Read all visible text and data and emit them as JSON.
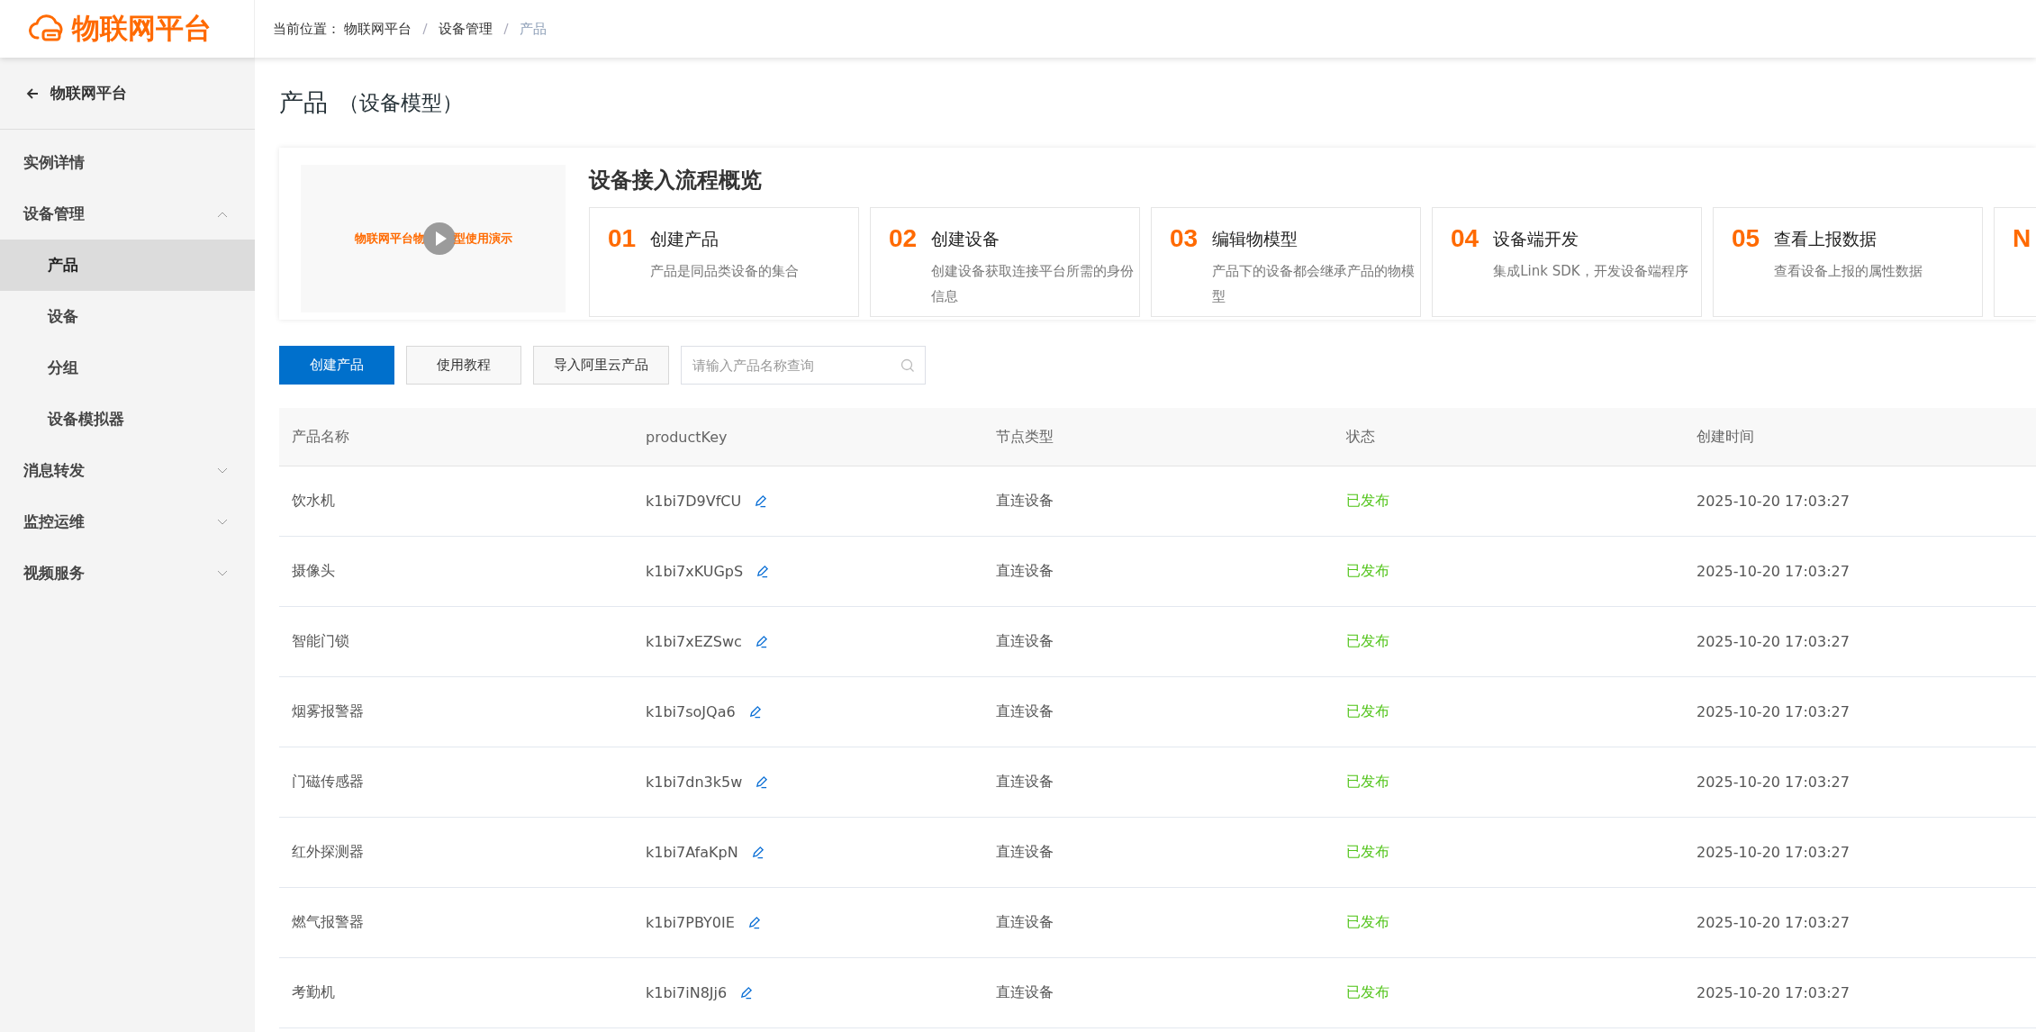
{
  "header": {
    "logo": "物联网平台",
    "breadcrumb_label": "当前位置：",
    "breadcrumb": [
      {
        "label": "物联网平台",
        "current": false
      },
      {
        "label": "设备管理",
        "current": false
      },
      {
        "label": "产品",
        "current": true
      }
    ]
  },
  "sidebar": {
    "back": "物联网平台",
    "items": [
      {
        "label": "实例详情",
        "kind": "link"
      },
      {
        "label": "设备管理",
        "kind": "group",
        "expanded": true,
        "children": [
          {
            "label": "产品",
            "selected": true
          },
          {
            "label": "设备",
            "selected": false
          },
          {
            "label": "分组",
            "selected": false
          },
          {
            "label": "设备模拟器",
            "selected": false
          }
        ]
      },
      {
        "label": "消息转发",
        "kind": "group",
        "expanded": false
      },
      {
        "label": "监控运维",
        "kind": "group",
        "expanded": false
      },
      {
        "label": "视频服务",
        "kind": "group",
        "expanded": false
      }
    ]
  },
  "page": {
    "title": "产品",
    "subtitle": "（设备模型）"
  },
  "overview": {
    "video_caption_before": "物联网平台物",
    "video_caption_after": "型使用演示",
    "title": "设备接入流程概览",
    "steps": [
      {
        "number": "01",
        "title": "创建产品",
        "text": "产品是同品类设备的集合"
      },
      {
        "number": "02",
        "title": "创建设备",
        "text": "创建设备获取连接平台所需的身份信息"
      },
      {
        "number": "03",
        "title": "编辑物模型",
        "text": "产品下的设备都会继承产品的物模型"
      },
      {
        "number": "04",
        "title": "设备端开发",
        "text": "集成Link SDK，开发设备端程序"
      },
      {
        "number": "05",
        "title": "查看上报数据",
        "text": "查看设备上报的属性数据"
      },
      {
        "number": "N"
      }
    ]
  },
  "toolbar": {
    "buttons": [
      {
        "label": "创建产品",
        "kind": "primary"
      },
      {
        "label": "使用教程",
        "kind": "default"
      },
      {
        "label": "导入阿里云产品",
        "kind": "default"
      }
    ],
    "search": {
      "placeholder": "请输入产品名称查询"
    }
  },
  "table": {
    "columns": [
      "产品名称",
      "productKey",
      "节点类型",
      "状态",
      "创建时间"
    ],
    "rows": [
      {
        "name": "饮水机",
        "key": "k1bi7D9VfCU",
        "node": "直连设备",
        "status": "已发布",
        "created": "2025-10-20 17:03:27"
      },
      {
        "name": "摄像头",
        "key": "k1bi7xKUGpS",
        "node": "直连设备",
        "status": "已发布",
        "created": "2025-10-20 17:03:27"
      },
      {
        "name": "智能门锁",
        "key": "k1bi7xEZSwc",
        "node": "直连设备",
        "status": "已发布",
        "created": "2025-10-20 17:03:27"
      },
      {
        "name": "烟雾报警器",
        "key": "k1bi7soJQa6",
        "node": "直连设备",
        "status": "已发布",
        "created": "2025-10-20 17:03:27"
      },
      {
        "name": "门磁传感器",
        "key": "k1bi7dn3k5w",
        "node": "直连设备",
        "status": "已发布",
        "created": "2025-10-20 17:03:27"
      },
      {
        "name": "红外探测器",
        "key": "k1bi7AfaKpN",
        "node": "直连设备",
        "status": "已发布",
        "created": "2025-10-20 17:03:27"
      },
      {
        "name": "燃气报警器",
        "key": "k1bi7PBY0IE",
        "node": "直连设备",
        "status": "已发布",
        "created": "2025-10-20 17:03:27"
      },
      {
        "name": "考勤机",
        "key": "k1bi7iN8Jj6",
        "node": "直连设备",
        "status": "已发布",
        "created": "2025-10-20 17:03:27"
      }
    ]
  }
}
